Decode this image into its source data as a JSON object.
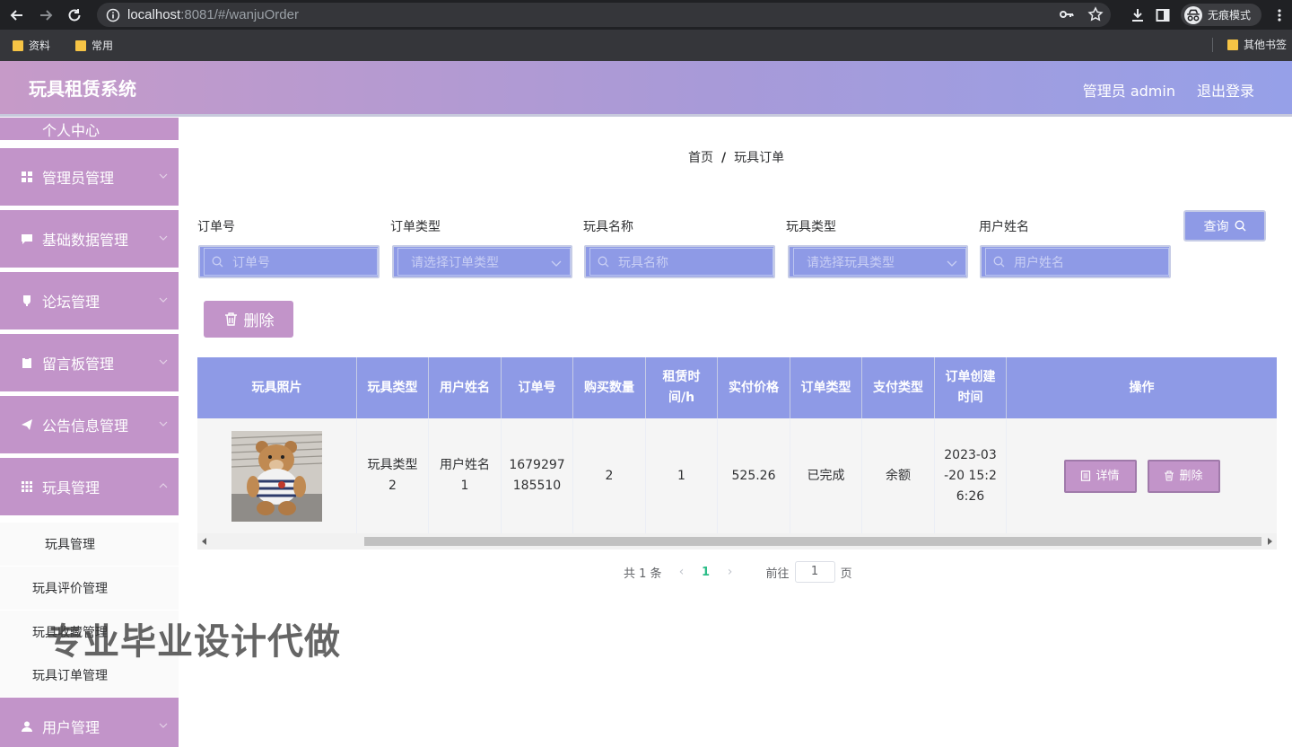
{
  "browser": {
    "url_host": "localhost",
    "url_rest": ":8081/#/wanjuOrder",
    "incognito_label": "无痕模式",
    "bookmarks": [
      "资料",
      "常用"
    ],
    "other_bookmarks": "其他书签"
  },
  "header": {
    "title": "玩具租赁系统",
    "user": "管理员 admin",
    "logout": "退出登录"
  },
  "sidebar": {
    "cut_item": "个人中心",
    "items": [
      {
        "label": "管理员管理",
        "icon": "grid-icon"
      },
      {
        "label": "基础数据管理",
        "icon": "message-icon"
      },
      {
        "label": "论坛管理",
        "icon": "cup-icon"
      },
      {
        "label": "留言板管理",
        "icon": "clipboard-icon"
      },
      {
        "label": "公告信息管理",
        "icon": "paper-plane-icon"
      },
      {
        "label": "玩具管理",
        "icon": "apps-icon"
      }
    ],
    "sub_items": [
      "玩具管理",
      "玩具评价管理",
      "玩具收藏管理",
      "玩具订单管理"
    ],
    "last_item": {
      "label": "用户管理",
      "icon": "user-icon"
    }
  },
  "breadcrumb": {
    "home": "首页",
    "sep": "/",
    "current": "玩具订单"
  },
  "filters": [
    {
      "label": "订单号",
      "placeholder": "订单号",
      "type": "input"
    },
    {
      "label": "订单类型",
      "placeholder": "请选择订单类型",
      "type": "select"
    },
    {
      "label": "玩具名称",
      "placeholder": "玩具名称",
      "type": "input"
    },
    {
      "label": "玩具类型",
      "placeholder": "请选择玩具类型",
      "type": "select"
    },
    {
      "label": "用户姓名",
      "placeholder": "用户姓名",
      "type": "input"
    }
  ],
  "buttons": {
    "query": "查询",
    "delete": "删除"
  },
  "table": {
    "headers": [
      "玩具照片",
      "玩具类型",
      "用户姓名",
      "订单号",
      "购买数量",
      "租赁时间/h",
      "实付价格",
      "订单类型",
      "支付类型",
      "订单创建时间",
      "操作"
    ],
    "rows": [
      {
        "toy_type": "玩具类型2",
        "user_name": "用户姓名1",
        "order_no": "1679297185510",
        "quantity": "2",
        "rent_hours": "1",
        "price": "525.26",
        "order_type": "已完成",
        "pay_type": "余额",
        "created": "2023-03-20 15:26:26",
        "detail_label": "详情",
        "delete_label": "删除"
      }
    ]
  },
  "pagination": {
    "total": "共 1 条",
    "current": "1",
    "goto": "前往",
    "page_value": "1",
    "page_suffix": "页"
  },
  "watermark": "专业毕业设计代做",
  "colors": {
    "primary": "#8e9ae6",
    "accent": "#c294c9",
    "page_active": "#2bbd87"
  }
}
